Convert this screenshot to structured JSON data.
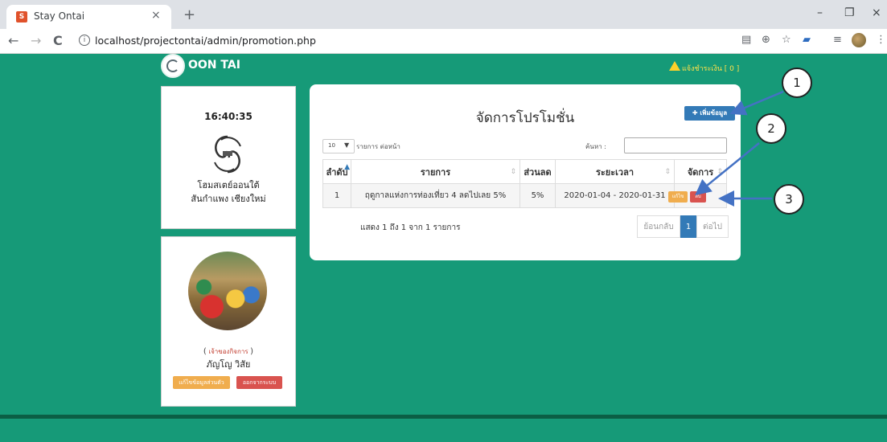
{
  "browser": {
    "tab_title": "Stay Ontai",
    "tab_close": "×",
    "new_tab": "+",
    "url": "localhost/projectontai/admin/promotion.php",
    "back": "←",
    "forward": "→",
    "reload": "C",
    "info": "i",
    "win_minimize": "–",
    "win_restore": "❐",
    "win_close": "×"
  },
  "header": {
    "brand": "OON TAI",
    "notification": "แจ้งชำระเงิน [ 0 ]"
  },
  "sidebar": {
    "clock": "16:40:35",
    "hotel_name_line1": "โฮมสเตย์ออนใต้",
    "hotel_name_line2": "สันกำแพง เชียงใหม่",
    "role": "เจ้าของกิจการ",
    "role_open": "(",
    "role_close": ")",
    "user_name": "ภัญโญ วิสัย",
    "edit_profile_label": "แก้ไขข้อมูลส่วนตัว",
    "logout_label": "ออกจากระบบ"
  },
  "main": {
    "title": "จัดการโปรโมชั่น",
    "add_button_label": "✚ เพิ่มข้อมูล",
    "page_length_value": "10",
    "page_length_label": "รายการ ต่อหน้า",
    "search_label": "ค้นหา :",
    "columns": [
      "ลำดับ",
      "รายการ",
      "ส่วนลด",
      "ระยะเวลา",
      "จัดการ"
    ],
    "rows": [
      {
        "no": "1",
        "item": "ฤดูกาลแห่งการท่องเที่ยว 4 ลดไปเลย 5%",
        "discount": "5%",
        "period": "2020-01-04 - 2020-01-31",
        "edit_label": "แก้ไข",
        "delete_label": "ลบ"
      }
    ],
    "info_text": "แสดง 1 ถึง 1 จาก 1 รายการ",
    "pagination": {
      "previous": "ย้อนกลับ",
      "current": "1",
      "next": "ต่อไป"
    }
  },
  "annotations": {
    "callout_1": "1",
    "callout_2": "2",
    "callout_3": "3",
    "arrow_color": "#4472c4"
  }
}
